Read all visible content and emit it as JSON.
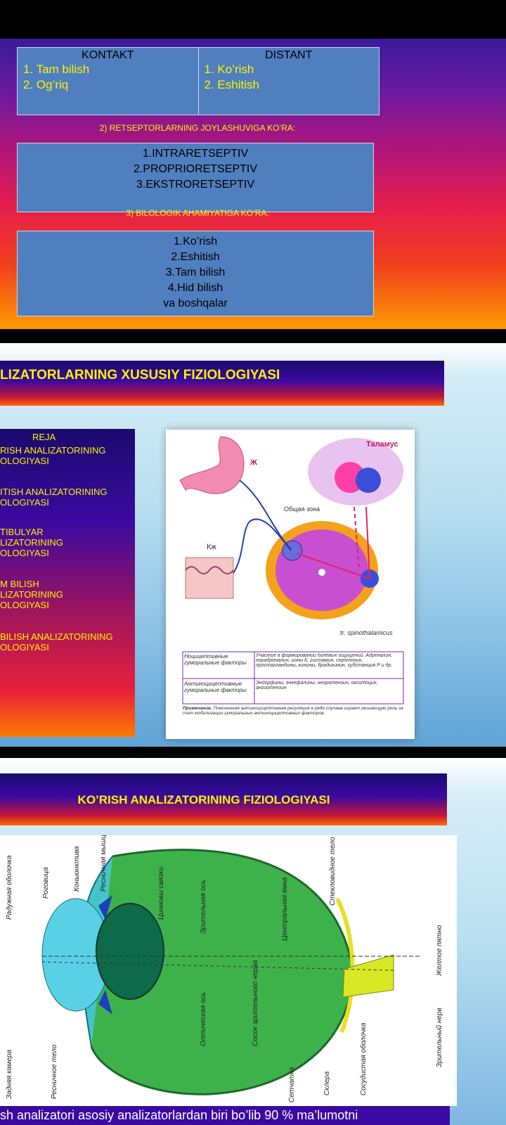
{
  "slide1": {
    "table": {
      "left_header": "KONTAKT",
      "left_items": [
        "1. Tam bilish",
        "2. Og’riq"
      ],
      "right_header": "DISTANT",
      "right_items": [
        "1. Ko’rish",
        "2. Eshitish"
      ]
    },
    "caption2": "2) RETSEPTORLARNING JOYLASHUVIGA KO’RA:",
    "box2_items": [
      "1.INTRARETSEPTIV",
      "2.PROPRIORETSEPTIV",
      "3.EKSTRORETSEPTIV"
    ],
    "caption3": "3) BILOLOGIK AHAMIYATIGA KO’RA:",
    "box3_items": [
      "1.Ko’rish",
      "2.Eshitish",
      "3.Tam bilish",
      "4.Hid bilish",
      "va boshqalar"
    ]
  },
  "slide2": {
    "title": "LIZATORLARNING XUSUSIY FIZIOLOGIYASI",
    "reja_title": "REJA",
    "reja_items": [
      [
        "RISH ANALIZATORINING",
        "OLOGIYASI"
      ],
      [
        "ITISH ANALIZATORINING",
        "OLOGIYASI"
      ],
      [
        "TIBULYAR",
        "LIZATORINING",
        "OLOGIYASI"
      ],
      [
        "M BILISH",
        "LIZATORINING",
        "OLOGIYASI"
      ],
      [
        "BILISH ANALIZATORINING",
        "OLOGIYASI"
      ]
    ],
    "diagram": {
      "label_thalamus": "Таламус",
      "label_stomach": "Ж",
      "label_skin": "Кж",
      "label_common_zone": "Общая зона",
      "label_tract": "tr. spinothalamicus",
      "table_rows": [
        [
          "Ноцицептивные гуморальные факторы",
          "Участие в формировании болевых ощущений. Адреналин, норадреналин, ионы К, гистамин, серотонин, простагландины, кинины, брадикинин, субстанция Р и др."
        ],
        [
          "Антиноцицептивные гуморальные факторы",
          "Эндорфины, энкефалины, нейротензин, окситоцин, ангиотензин"
        ]
      ],
      "note_title": "Примечание.",
      "note_text": "Помогенная антиноцицептивная регуляция в ряде случаев играет решающую роль за счет мобилизации гуморальных антиноцицептивных факторов."
    }
  },
  "slide3": {
    "title": "KO’RISH ANALIZATORINING FIZIOLOGIYASI",
    "eye_labels": {
      "raduzhnaya": "Радужная оболочка",
      "rogovitsa": "Роговица",
      "konyunktiva": "Коньюнктива",
      "resnichnaya_myshtsa": "Ресничная мышца",
      "tsinnovy": "Цинновы связки",
      "zritelnaya_os": "Зрительная ось",
      "tsentralnaya_yamka": "Центральная ямка",
      "steklovidnoe": "Стекловидное тело",
      "zheltoe_pyatno": "Желтое пятно",
      "opticheskaya_os": "Оптическая ось",
      "sosok": "Сосок зрительного нерва",
      "zritelny_nerv": "Зрительный нерв",
      "zadnyaya_kamera": "Задняя камера",
      "resnichnoe_telo": "Ресничное тело",
      "setchatka": "Сетчатка",
      "sklera": "Склера",
      "sosudistaya": "Сосудистая оболочка"
    },
    "footer_text": "sh analizatori asosiy analizatorlardan biri bo’lib 90 % ma’lumotni"
  }
}
